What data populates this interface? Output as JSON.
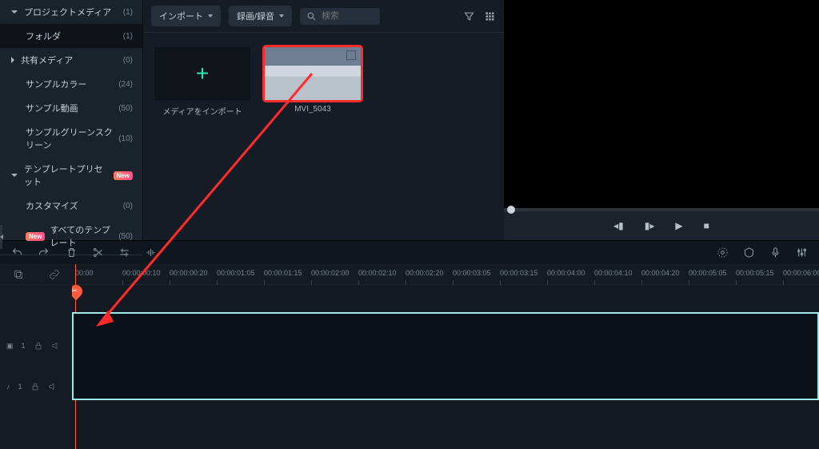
{
  "sidebar": {
    "items": [
      {
        "label": "プロジェクトメディア",
        "count": "(1)"
      },
      {
        "label": "フォルダ",
        "count": "(1)"
      },
      {
        "label": "共有メディア",
        "count": "(0)"
      },
      {
        "label": "サンプルカラー",
        "count": "(24)"
      },
      {
        "label": "サンプル動画",
        "count": "(50)"
      },
      {
        "label": "サンプルグリーンスクリーン",
        "count": "(10)"
      },
      {
        "label": "テンプレートプリセット",
        "count": ""
      },
      {
        "label": "カスタマイズ",
        "count": "(0)"
      },
      {
        "label": "すべてのテンプレート",
        "count": "(50)"
      }
    ]
  },
  "media": {
    "import_label": "インポート",
    "record_label": "録画/録音",
    "search_placeholder": "検索",
    "import_tile_label": "メディアをインポート",
    "clip_label": "MVI_5043"
  },
  "preview": {
    "buttons": [
      "prev",
      "step-back",
      "play",
      "stop"
    ]
  },
  "timeline": {
    "ticks": [
      "00:00",
      "00:00:00:10",
      "00:00:00:20",
      "00:00:01:05",
      "00:00:01:15",
      "00:00:02:00",
      "00:00:02:10",
      "00:00:02:20",
      "00:00:03:05",
      "00:00:03:15",
      "00:00:04:00",
      "00:00:04:10",
      "00:00:04:20",
      "00:00:05:05",
      "00:00:05:15",
      "00:00:06:00"
    ],
    "video_track_label": "1",
    "audio_track_label": "1"
  },
  "colors": {
    "accent_red": "#ff2b2b",
    "accent_teal": "#9fe8ea",
    "playhead": "#ff5a3c"
  }
}
